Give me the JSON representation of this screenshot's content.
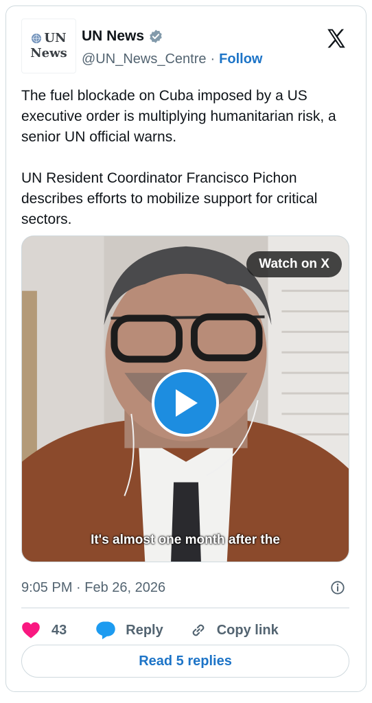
{
  "account": {
    "logo_line1": "UN",
    "logo_line2": "News",
    "display_name": "UN News",
    "handle": "@UN_News_Centre",
    "separator": "·",
    "follow_label": "Follow"
  },
  "tweet": {
    "text": "The fuel blockade on Cuba imposed by a US executive order is multiplying humanitarian risk, a senior UN official warns.\n\nUN Resident Coordinator Francisco Pichon describes efforts to mobilize support for critical sectors."
  },
  "media": {
    "watch_label": "Watch on X",
    "caption": "It's almost one month after the"
  },
  "meta": {
    "timestamp": "9:05 PM · Feb 26, 2026"
  },
  "actions": {
    "like_count": "43",
    "reply_label": "Reply",
    "copy_label": "Copy link"
  },
  "footer": {
    "read_replies_label": "Read 5 replies"
  },
  "colors": {
    "accent": "#1d74c7",
    "like": "#f91880",
    "reply_icon": "#1d9bf0",
    "verified": "#829aab"
  }
}
